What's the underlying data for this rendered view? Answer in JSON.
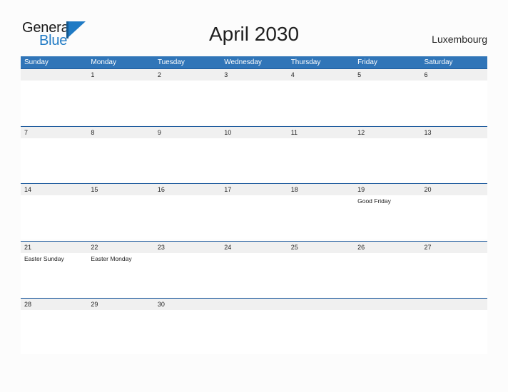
{
  "logo": {
    "word_top": "General",
    "word_bottom": "Blue",
    "mark_icon": "triangle-flag-icon",
    "color_dark": "#15598f",
    "color_blue": "#1f7ac4"
  },
  "header": {
    "title": "April 2030",
    "region": "Luxembourg"
  },
  "colors": {
    "header_blue": "#3075b8",
    "row_divider_blue": "#1f5c9e",
    "daynum_band": "#f0f0f0",
    "page_background": "#fcfcfc"
  },
  "calendar": {
    "weekdays": [
      "Sunday",
      "Monday",
      "Tuesday",
      "Wednesday",
      "Thursday",
      "Friday",
      "Saturday"
    ],
    "weeks": [
      {
        "days": [
          {
            "num": "",
            "event": ""
          },
          {
            "num": "1",
            "event": ""
          },
          {
            "num": "2",
            "event": ""
          },
          {
            "num": "3",
            "event": ""
          },
          {
            "num": "4",
            "event": ""
          },
          {
            "num": "5",
            "event": ""
          },
          {
            "num": "6",
            "event": ""
          }
        ]
      },
      {
        "days": [
          {
            "num": "7",
            "event": ""
          },
          {
            "num": "8",
            "event": ""
          },
          {
            "num": "9",
            "event": ""
          },
          {
            "num": "10",
            "event": ""
          },
          {
            "num": "11",
            "event": ""
          },
          {
            "num": "12",
            "event": ""
          },
          {
            "num": "13",
            "event": ""
          }
        ]
      },
      {
        "days": [
          {
            "num": "14",
            "event": ""
          },
          {
            "num": "15",
            "event": ""
          },
          {
            "num": "16",
            "event": ""
          },
          {
            "num": "17",
            "event": ""
          },
          {
            "num": "18",
            "event": ""
          },
          {
            "num": "19",
            "event": "Good Friday"
          },
          {
            "num": "20",
            "event": ""
          }
        ]
      },
      {
        "days": [
          {
            "num": "21",
            "event": "Easter Sunday"
          },
          {
            "num": "22",
            "event": "Easter Monday"
          },
          {
            "num": "23",
            "event": ""
          },
          {
            "num": "24",
            "event": ""
          },
          {
            "num": "25",
            "event": ""
          },
          {
            "num": "26",
            "event": ""
          },
          {
            "num": "27",
            "event": ""
          }
        ]
      },
      {
        "days": [
          {
            "num": "28",
            "event": ""
          },
          {
            "num": "29",
            "event": ""
          },
          {
            "num": "30",
            "event": ""
          },
          {
            "num": "",
            "event": ""
          },
          {
            "num": "",
            "event": ""
          },
          {
            "num": "",
            "event": ""
          },
          {
            "num": "",
            "event": ""
          }
        ]
      }
    ]
  }
}
